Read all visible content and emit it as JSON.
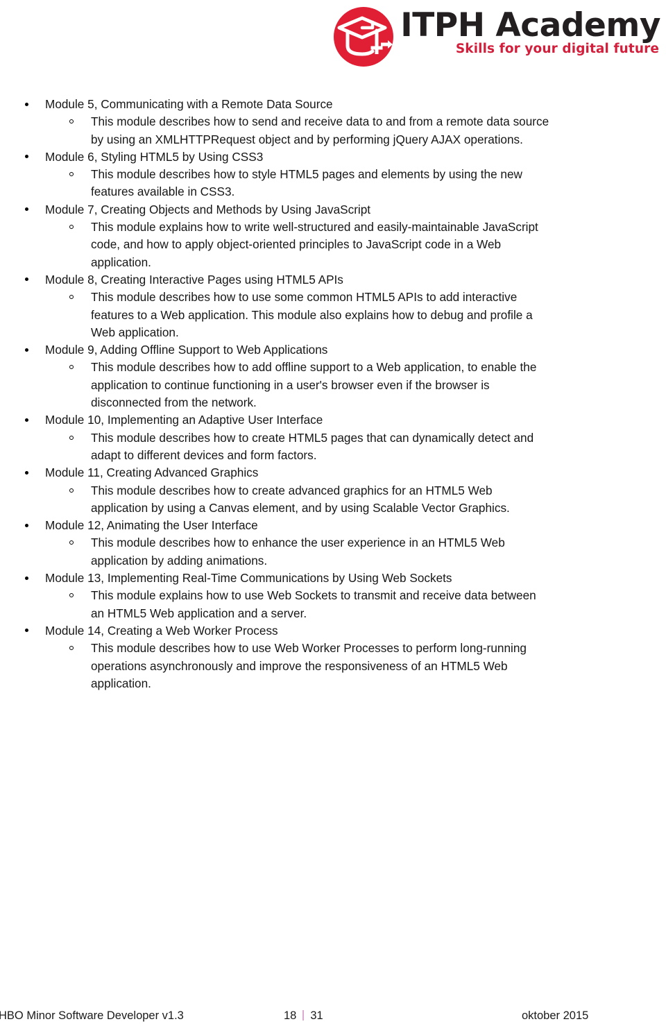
{
  "header": {
    "logo": {
      "icon_name": "graduation-cap-arrow-logo-icon",
      "circle_color": "#e01f35",
      "glyph_color": "#ffffff",
      "title": "ITPH Academy",
      "title_color": "#231f20",
      "tagline": "Skills for your digital future",
      "tagline_color": "#d11f3c"
    }
  },
  "content": {
    "modules": [
      {
        "title": "Module 5, Communicating with a Remote Data Source",
        "description": "This module describes how to send and receive data to and from a remote data source by using an XMLHTTPRequest object and by performing jQuery AJAX operations."
      },
      {
        "title": "Module 6, Styling HTML5 by Using CSS3",
        "description": "This module describes how to style HTML5 pages and elements by using the new features available in CSS3."
      },
      {
        "title": "Module 7, Creating Objects and Methods by Using JavaScript",
        "description": "This module explains how to write well-structured and easily-maintainable JavaScript code, and how to apply object-oriented principles to JavaScript code in a Web application."
      },
      {
        "title": "Module 8, Creating Interactive Pages using HTML5 APIs",
        "description": "This module describes how to use some common HTML5 APIs to add interactive features to a Web application. This module also explains how to debug and profile a Web application."
      },
      {
        "title": "Module 9, Adding Offline Support to Web Applications",
        "description": "This module describes how to add offline support to a Web application, to enable the application to continue functioning in a user's browser even if the browser is disconnected from the network."
      },
      {
        "title": "Module 10,  Implementing an Adaptive User Interface",
        "description": "This module describes how to create HTML5 pages that can dynamically detect and adapt to different devices and form factors."
      },
      {
        "title": "Module 11, Creating Advanced Graphics",
        "description": "This module describes how to create advanced graphics for an HTML5 Web application by using a Canvas element, and by using Scalable Vector Graphics."
      },
      {
        "title": "Module 12, Animating the User Interface",
        "description": "This module describes how to enhance the user experience in an HTML5 Web application by adding animations."
      },
      {
        "title": "Module 13, Implementing Real-Time Communications by Using Web Sockets",
        "description": "This module explains how to use Web Sockets to transmit and receive data between an HTML5 Web application and a server."
      },
      {
        "title": "Module 14, Creating a Web Worker Process",
        "description": "This module describes how to use Web Worker Processes to perform long-running operations asynchronously and improve the responsiveness of an HTML5 Web application."
      }
    ]
  },
  "footer": {
    "document_title": "HBO Minor Software Developer v1.3",
    "page_current": "18",
    "page_total": "31",
    "separator_color": "#dba8cf",
    "date": "oktober 2015"
  }
}
